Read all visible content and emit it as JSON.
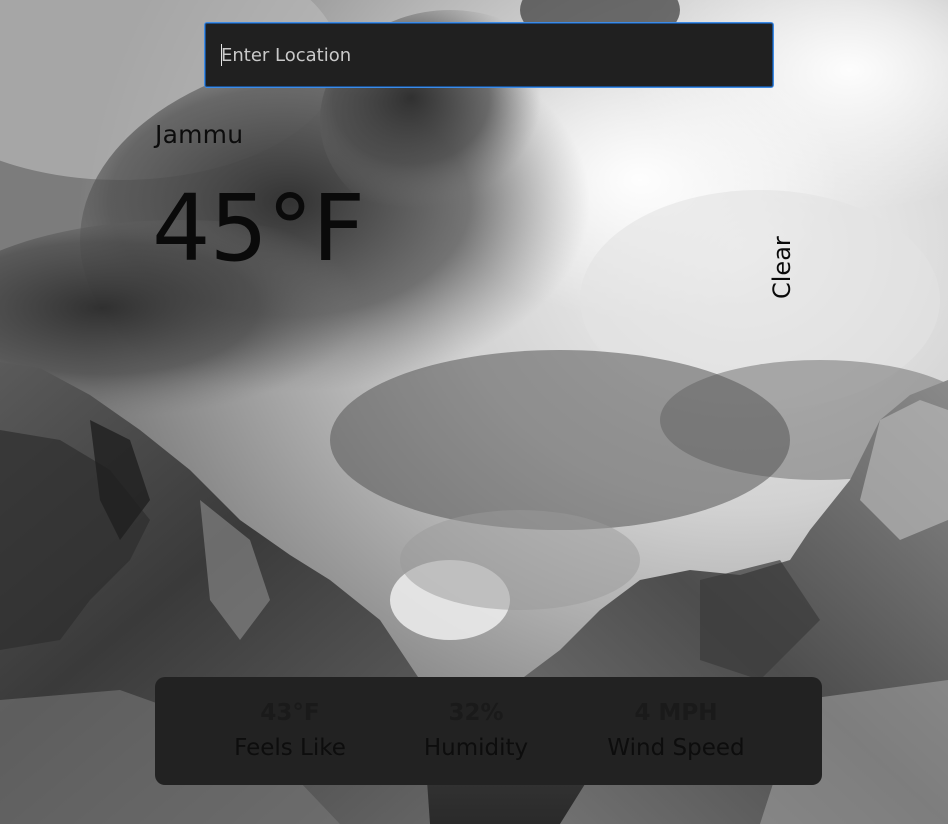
{
  "search": {
    "placeholder": "Enter Location",
    "value": ""
  },
  "weather": {
    "location": "Jammu",
    "temperature": "45°F",
    "condition": "Clear"
  },
  "stats": {
    "feels_like": {
      "value": "43°F",
      "label": "Feels Like"
    },
    "humidity": {
      "value": "32%",
      "label": "Humidity"
    },
    "wind_speed": {
      "value": "4 MPH",
      "label": "Wind Speed"
    }
  },
  "colors": {
    "panel": "#222222",
    "input_bg": "#202020",
    "input_border": "#3d8be6",
    "text_dark": "#0a0a0a"
  }
}
